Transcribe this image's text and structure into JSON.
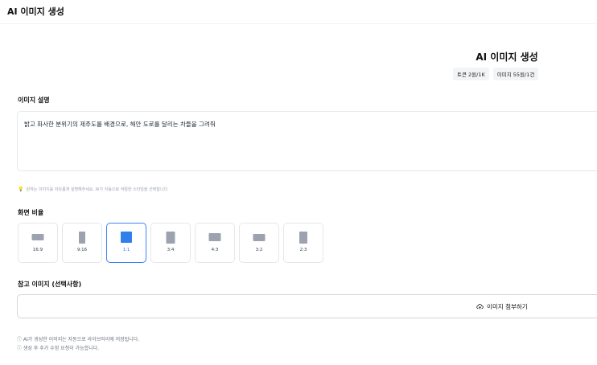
{
  "header": {
    "title": "AI 이미지 생성"
  },
  "hero": {
    "title": "AI 이미지 생성",
    "badges": [
      "토큰 2원/1K",
      "이미지 55원/1건"
    ]
  },
  "description": {
    "label": "이미지 설명",
    "value": "밝고 화사한 분위기의 제주도를 배경으로, 해안 도로를 달리는 차들을 그려줘",
    "hint": "원하는 이미지를 자유롭게 설명해주세요. AI가 자동으로 적절한 스타일을 선택합니다."
  },
  "aspect_ratio": {
    "label": "화면 비율",
    "options": [
      "16:9",
      "9:16",
      "1:1",
      "3:4",
      "4:3",
      "3:2",
      "2:3"
    ],
    "selected": "1:1"
  },
  "reference": {
    "label": "참고 이미지 (선택사항)",
    "button_label": "이미지 첨부하기"
  },
  "notes": [
    "ⓘ AI가 생성한 이미지는 자동으로 라이브러리에 저장됩니다.",
    "ⓘ 생성 후 추가 수정 요청이 가능합니다."
  ],
  "colors": {
    "accent": "#2f80ed",
    "hint_icon": "#f59e0b"
  },
  "icons": {
    "hint": "lightbulb-icon",
    "upload": "cloud-upload-icon"
  }
}
